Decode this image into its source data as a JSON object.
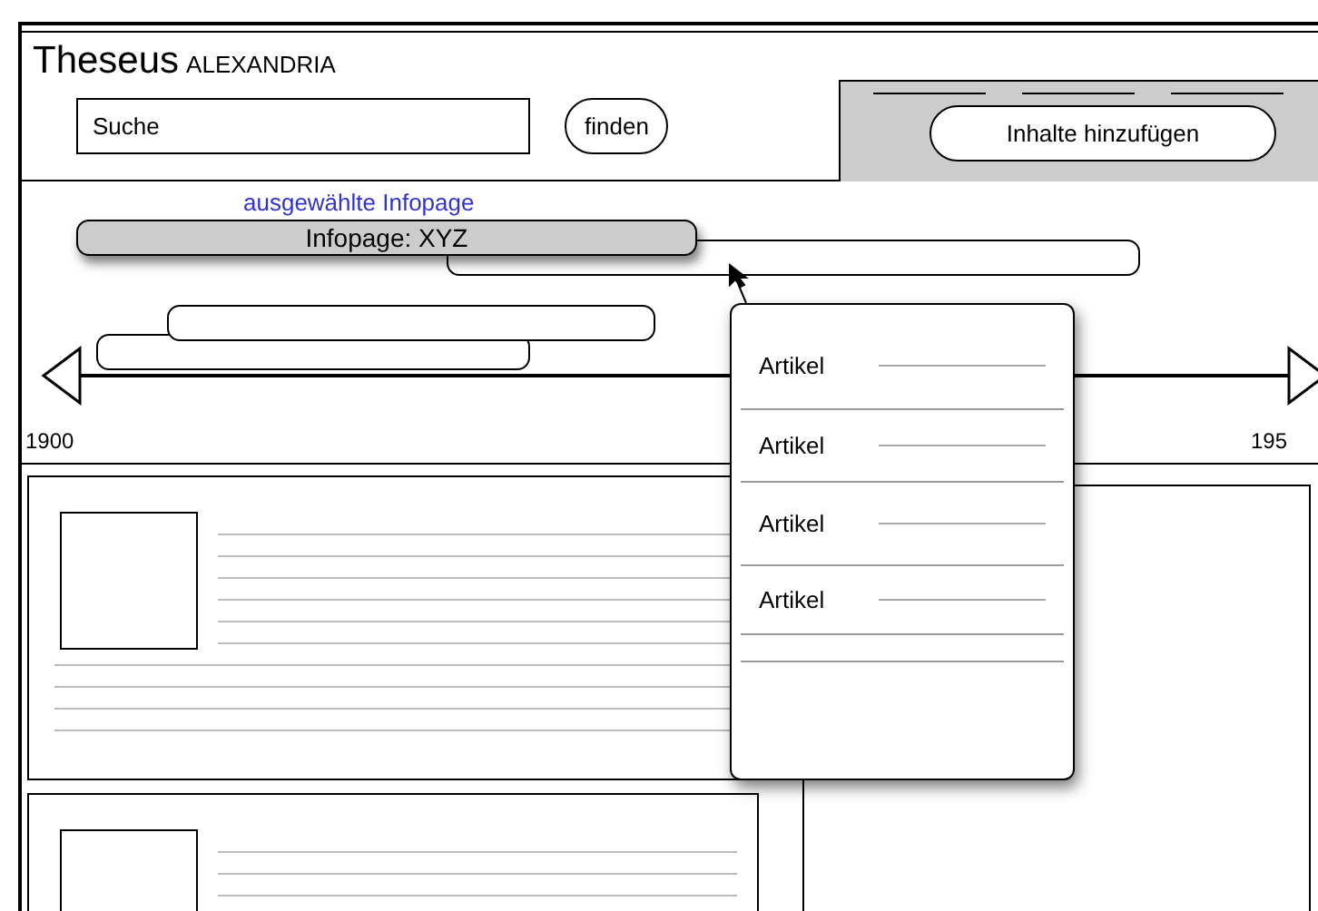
{
  "header": {
    "title": "Theseus",
    "subtitle": "ALEXANDRIA",
    "search": {
      "placeholder": "Suche"
    },
    "search_button": "finden",
    "add_button": "Inhalte hinzufügen"
  },
  "timeline": {
    "selected_caption": "ausgewählte Infopage",
    "entries": [
      {
        "label": "Infopage: XYZ",
        "selected": true
      },
      {
        "selected": false
      },
      {
        "selected": false
      },
      {
        "selected": false
      }
    ],
    "start": "1900",
    "end": "195"
  },
  "popup": {
    "items": [
      "Artikel",
      "Artikel",
      "Artikel",
      "Artikel"
    ]
  }
}
